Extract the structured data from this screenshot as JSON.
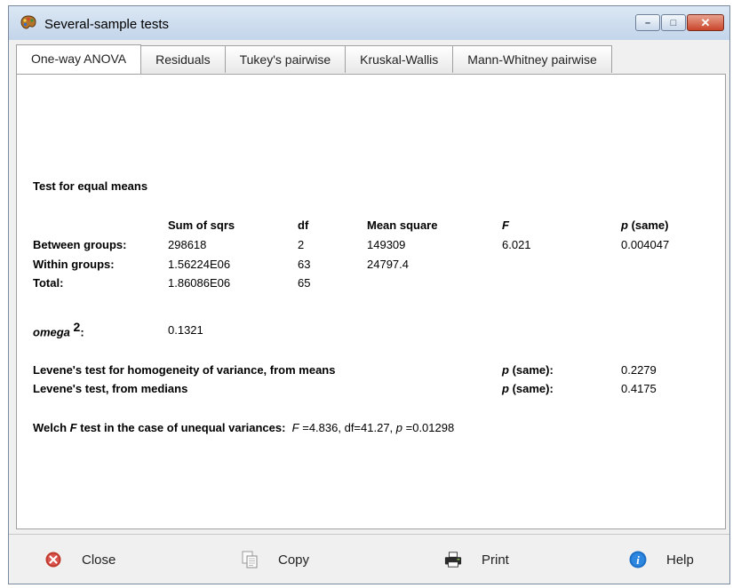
{
  "window": {
    "title": "Several-sample tests",
    "minimize_glyph": "–",
    "maximize_glyph": "□",
    "close_glyph": "✕"
  },
  "tabs": [
    {
      "label": "One-way ANOVA",
      "active": true
    },
    {
      "label": "Residuals",
      "active": false
    },
    {
      "label": "Tukey's pairwise",
      "active": false
    },
    {
      "label": "Kruskal-Wallis",
      "active": false
    },
    {
      "label": "Mann-Whitney pairwise",
      "active": false
    }
  ],
  "anova": {
    "heading": "Test for equal means",
    "columns": {
      "sum_of_sqrs": "Sum of sqrs",
      "df": "df",
      "mean_square": "Mean square",
      "f": "F",
      "p_same_italic": "p",
      "p_same_rest": " (same)"
    },
    "rows": [
      {
        "label": "Between groups:",
        "ss": "298618",
        "df": "2",
        "ms": "149309",
        "f": "6.021",
        "p": "0.004047"
      },
      {
        "label": "Within groups:",
        "ss": "1.56224E06",
        "df": "63",
        "ms": "24797.4"
      },
      {
        "label": "Total:",
        "ss": "1.86086E06",
        "df": "65"
      }
    ],
    "omega_label": "omega",
    "omega_sup": "2",
    "omega_colon": ":",
    "omega_value": "0.1321"
  },
  "levene": {
    "means_label": "Levene's test for homogeneity of variance, from means",
    "means_p_italic": "p",
    "means_p_rest": " (same):",
    "means_value": "0.2279",
    "medians_label": "Levene's test, from medians",
    "medians_p_italic": "p",
    "medians_p_rest": " (same):",
    "medians_value": "0.4175"
  },
  "welch": {
    "label_pre": "Welch ",
    "label_f": "F",
    "label_post": " test in the case of unequal variances:",
    "f_italic": "F",
    "f_value": " =4.836, df=41.27, ",
    "p_italic": "p",
    "p_value": " =0.01298"
  },
  "footer": {
    "close_label": "Close",
    "copy_label": "Copy",
    "print_label": "Print",
    "help_label": "Help"
  },
  "colors": {
    "close_icon": "#c0392b",
    "help_icon": "#1b6fc4",
    "close_button": "#c9452a"
  },
  "icons": {
    "app": "palette-icon",
    "close": "close-circle-icon",
    "copy": "copy-icon",
    "print": "printer-icon",
    "help": "info-icon"
  }
}
